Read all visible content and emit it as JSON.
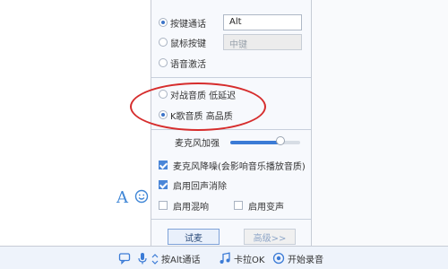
{
  "panel": {
    "options": [
      {
        "label": "按键通话",
        "checked": true
      },
      {
        "label": "鼠标按键",
        "checked": false
      },
      {
        "label": "语音激活",
        "checked": false
      }
    ],
    "fields": {
      "push_key": "Alt",
      "mouse_key": "中键"
    },
    "quality": [
      {
        "label": "对战音质 低延迟",
        "checked": false
      },
      {
        "label": "K歌音质 高品质",
        "checked": true
      }
    ],
    "mic_boost_label": "麦克风加强",
    "mic_boost_level": 0.72,
    "checkboxes": [
      {
        "label": "麦克风降噪(会影响音乐播放音质)",
        "checked": true
      },
      {
        "label": "启用回声消除",
        "checked": true
      },
      {
        "label": "启用混响",
        "checked": false
      },
      {
        "label": "启用变声",
        "checked": false
      }
    ],
    "buttons": {
      "try_listen": "试麦",
      "advanced": "高级>>"
    }
  },
  "bottom_bar": {
    "push_to_talk": "按Alt通话",
    "karaoke": "卡拉OK",
    "record": "开始录音"
  },
  "format_bar": {
    "font_glyph": "A"
  },
  "colors": {
    "accent": "#3b7bd6",
    "annotation": "#d62d2d"
  }
}
